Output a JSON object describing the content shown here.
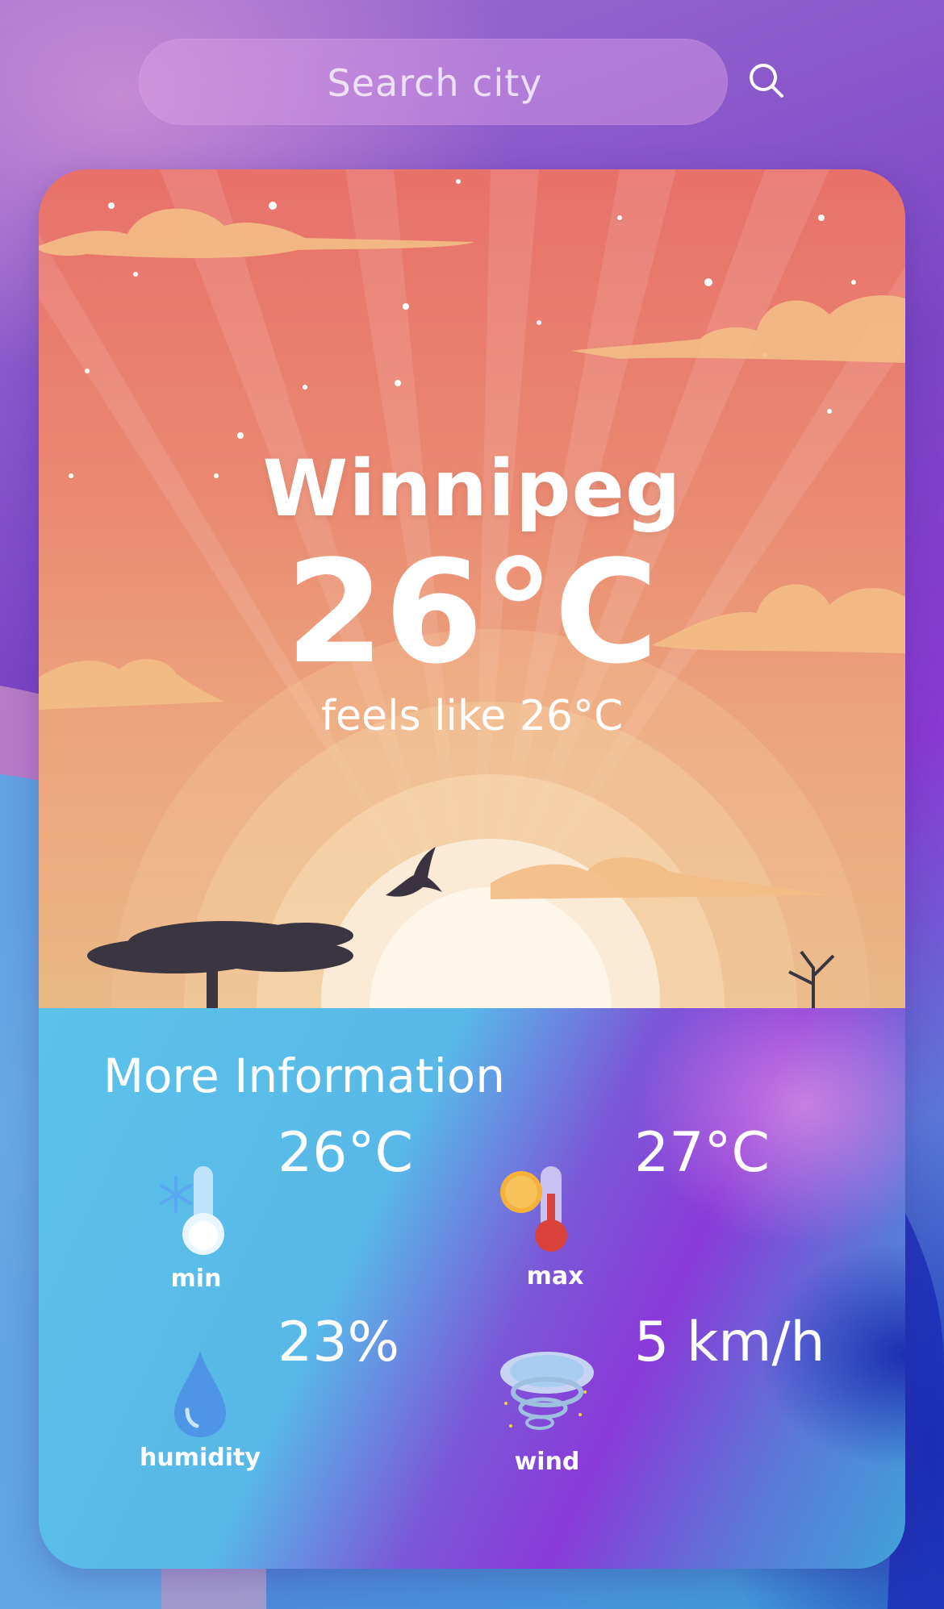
{
  "search": {
    "placeholder": "Search city"
  },
  "weather": {
    "city": "Winnipeg",
    "temperature": "26°C",
    "feels_like": "feels like 26°C"
  },
  "more_info": {
    "title": "More Information",
    "stats": [
      {
        "caption": "min",
        "value": "26°C",
        "icon": "thermometer-cold-icon"
      },
      {
        "caption": "max",
        "value": "27°C",
        "icon": "thermometer-hot-icon"
      },
      {
        "caption": "humidity",
        "value": "23%",
        "icon": "water-drop-icon"
      },
      {
        "caption": "wind",
        "value": "5 km/h",
        "icon": "wind-icon"
      }
    ]
  },
  "colors": {
    "hero_top": "#e8716a",
    "hero_bottom": "#e9b886",
    "info_light": "#5cc2ea",
    "info_purple": "#8a3ad8"
  }
}
